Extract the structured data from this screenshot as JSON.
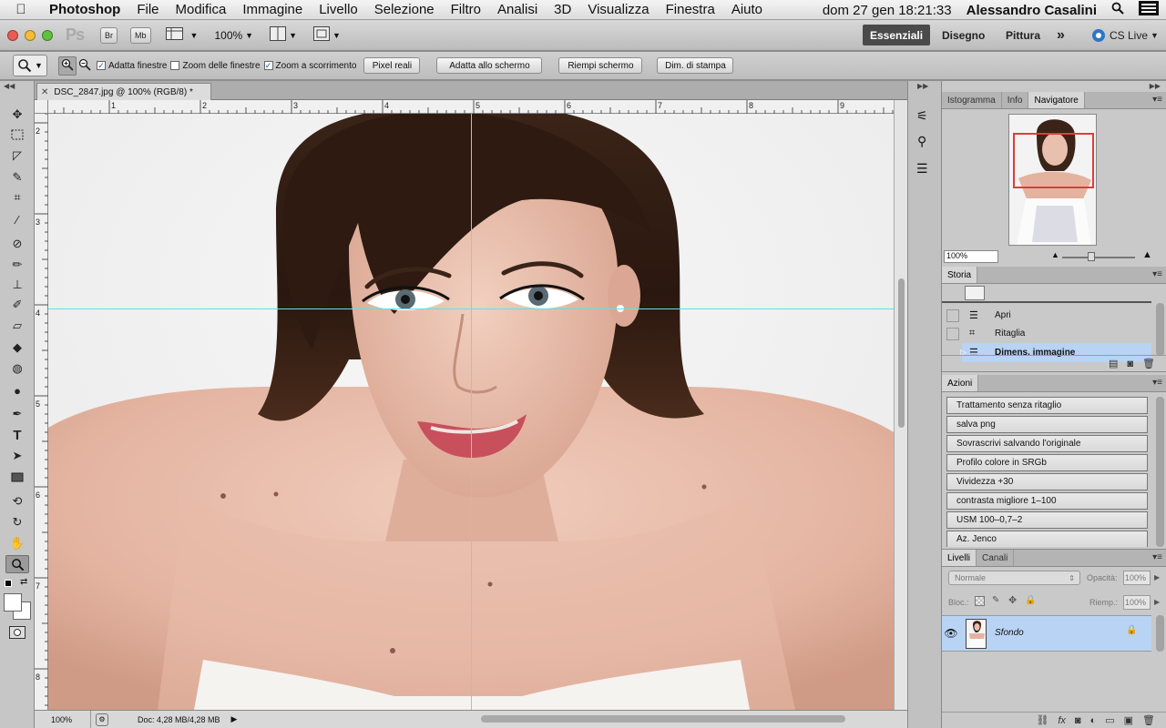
{
  "menubar": {
    "app": "Photoshop",
    "items": [
      "File",
      "Modifica",
      "Immagine",
      "Livello",
      "Selezione",
      "Filtro",
      "Analisi",
      "3D",
      "Visualizza",
      "Finestra",
      "Aiuto"
    ],
    "clock": "dom 27 gen  18:21:33",
    "user": "Alessandro  Casalini"
  },
  "appbar": {
    "logo": "Ps",
    "br": "Br",
    "mb": "Mb",
    "zoom": "100%",
    "workspaces": [
      "Essenziali",
      "Disegno",
      "Pittura"
    ],
    "more": "»",
    "cslive": "CS Live"
  },
  "options": {
    "adatta": "Adatta finestre",
    "zoomtutte": "Zoom delle finestre",
    "zoomscorr": "Zoom a scorrimento",
    "pixel": "Pixel reali",
    "schermo": "Adatta allo schermo",
    "riempi": "Riempi schermo",
    "stampa": "Dim. di stampa"
  },
  "document": {
    "tab": "DSC_2847.jpg @ 100% (RGB/8) *",
    "hruler": [
      "1",
      "2",
      "3",
      "4",
      "5",
      "6",
      "7",
      "8",
      "9"
    ],
    "vruler": [
      "2",
      "3",
      "4",
      "5",
      "6",
      "7",
      "8"
    ]
  },
  "status": {
    "zoom": "100%",
    "doc": "Doc: 4,28 MB/4,28 MB"
  },
  "navigator": {
    "tabs": [
      "Istogramma",
      "Info",
      "Navigatore"
    ],
    "zoom": "100%"
  },
  "history": {
    "tab": "Storia",
    "items": [
      "Apri",
      "Ritaglia",
      "Dimens. immagine"
    ]
  },
  "actions": {
    "tab": "Azioni",
    "items": [
      "Trattamento senza ritaglio",
      "salva png",
      "Sovrascrivi salvando l'originale",
      "Profilo colore in SRGb",
      "Vividezza +30",
      "contrasta migliore 1–100",
      "USM 100–0,7–2",
      "Az. Jenco"
    ]
  },
  "layers": {
    "tabs": [
      "Livelli",
      "Canali"
    ],
    "blend": "Normale",
    "opacity_label": "Opacità:",
    "opacity": "100%",
    "lock_label": "Bloc.:",
    "fill_label": "Riemp.:",
    "fill": "100%",
    "layer": "Sfondo"
  },
  "colors": {
    "accent": "#b9d3f4",
    "guide": "#5ee0f0",
    "navframe": "#e23b3b"
  }
}
